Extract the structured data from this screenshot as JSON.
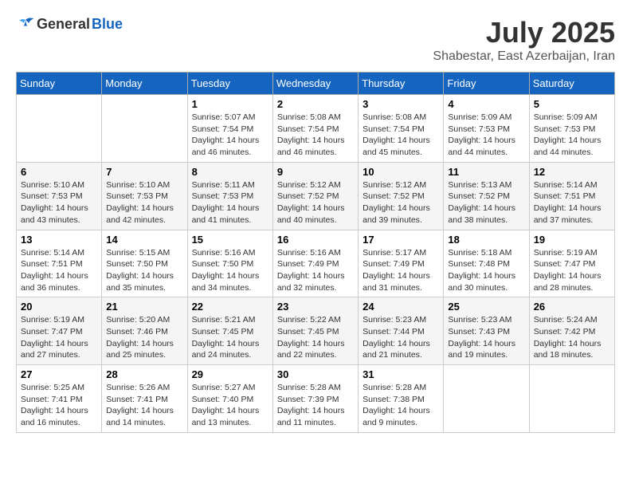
{
  "logo": {
    "general": "General",
    "blue": "Blue"
  },
  "title": "July 2025",
  "subtitle": "Shabestar, East Azerbaijan, Iran",
  "days_of_week": [
    "Sunday",
    "Monday",
    "Tuesday",
    "Wednesday",
    "Thursday",
    "Friday",
    "Saturday"
  ],
  "weeks": [
    [
      {
        "day": "",
        "info": ""
      },
      {
        "day": "",
        "info": ""
      },
      {
        "day": "1",
        "info": "Sunrise: 5:07 AM\nSunset: 7:54 PM\nDaylight: 14 hours and 46 minutes."
      },
      {
        "day": "2",
        "info": "Sunrise: 5:08 AM\nSunset: 7:54 PM\nDaylight: 14 hours and 46 minutes."
      },
      {
        "day": "3",
        "info": "Sunrise: 5:08 AM\nSunset: 7:54 PM\nDaylight: 14 hours and 45 minutes."
      },
      {
        "day": "4",
        "info": "Sunrise: 5:09 AM\nSunset: 7:53 PM\nDaylight: 14 hours and 44 minutes."
      },
      {
        "day": "5",
        "info": "Sunrise: 5:09 AM\nSunset: 7:53 PM\nDaylight: 14 hours and 44 minutes."
      }
    ],
    [
      {
        "day": "6",
        "info": "Sunrise: 5:10 AM\nSunset: 7:53 PM\nDaylight: 14 hours and 43 minutes."
      },
      {
        "day": "7",
        "info": "Sunrise: 5:10 AM\nSunset: 7:53 PM\nDaylight: 14 hours and 42 minutes."
      },
      {
        "day": "8",
        "info": "Sunrise: 5:11 AM\nSunset: 7:53 PM\nDaylight: 14 hours and 41 minutes."
      },
      {
        "day": "9",
        "info": "Sunrise: 5:12 AM\nSunset: 7:52 PM\nDaylight: 14 hours and 40 minutes."
      },
      {
        "day": "10",
        "info": "Sunrise: 5:12 AM\nSunset: 7:52 PM\nDaylight: 14 hours and 39 minutes."
      },
      {
        "day": "11",
        "info": "Sunrise: 5:13 AM\nSunset: 7:52 PM\nDaylight: 14 hours and 38 minutes."
      },
      {
        "day": "12",
        "info": "Sunrise: 5:14 AM\nSunset: 7:51 PM\nDaylight: 14 hours and 37 minutes."
      }
    ],
    [
      {
        "day": "13",
        "info": "Sunrise: 5:14 AM\nSunset: 7:51 PM\nDaylight: 14 hours and 36 minutes."
      },
      {
        "day": "14",
        "info": "Sunrise: 5:15 AM\nSunset: 7:50 PM\nDaylight: 14 hours and 35 minutes."
      },
      {
        "day": "15",
        "info": "Sunrise: 5:16 AM\nSunset: 7:50 PM\nDaylight: 14 hours and 34 minutes."
      },
      {
        "day": "16",
        "info": "Sunrise: 5:16 AM\nSunset: 7:49 PM\nDaylight: 14 hours and 32 minutes."
      },
      {
        "day": "17",
        "info": "Sunrise: 5:17 AM\nSunset: 7:49 PM\nDaylight: 14 hours and 31 minutes."
      },
      {
        "day": "18",
        "info": "Sunrise: 5:18 AM\nSunset: 7:48 PM\nDaylight: 14 hours and 30 minutes."
      },
      {
        "day": "19",
        "info": "Sunrise: 5:19 AM\nSunset: 7:47 PM\nDaylight: 14 hours and 28 minutes."
      }
    ],
    [
      {
        "day": "20",
        "info": "Sunrise: 5:19 AM\nSunset: 7:47 PM\nDaylight: 14 hours and 27 minutes."
      },
      {
        "day": "21",
        "info": "Sunrise: 5:20 AM\nSunset: 7:46 PM\nDaylight: 14 hours and 25 minutes."
      },
      {
        "day": "22",
        "info": "Sunrise: 5:21 AM\nSunset: 7:45 PM\nDaylight: 14 hours and 24 minutes."
      },
      {
        "day": "23",
        "info": "Sunrise: 5:22 AM\nSunset: 7:45 PM\nDaylight: 14 hours and 22 minutes."
      },
      {
        "day": "24",
        "info": "Sunrise: 5:23 AM\nSunset: 7:44 PM\nDaylight: 14 hours and 21 minutes."
      },
      {
        "day": "25",
        "info": "Sunrise: 5:23 AM\nSunset: 7:43 PM\nDaylight: 14 hours and 19 minutes."
      },
      {
        "day": "26",
        "info": "Sunrise: 5:24 AM\nSunset: 7:42 PM\nDaylight: 14 hours and 18 minutes."
      }
    ],
    [
      {
        "day": "27",
        "info": "Sunrise: 5:25 AM\nSunset: 7:41 PM\nDaylight: 14 hours and 16 minutes."
      },
      {
        "day": "28",
        "info": "Sunrise: 5:26 AM\nSunset: 7:41 PM\nDaylight: 14 hours and 14 minutes."
      },
      {
        "day": "29",
        "info": "Sunrise: 5:27 AM\nSunset: 7:40 PM\nDaylight: 14 hours and 13 minutes."
      },
      {
        "day": "30",
        "info": "Sunrise: 5:28 AM\nSunset: 7:39 PM\nDaylight: 14 hours and 11 minutes."
      },
      {
        "day": "31",
        "info": "Sunrise: 5:28 AM\nSunset: 7:38 PM\nDaylight: 14 hours and 9 minutes."
      },
      {
        "day": "",
        "info": ""
      },
      {
        "day": "",
        "info": ""
      }
    ]
  ]
}
